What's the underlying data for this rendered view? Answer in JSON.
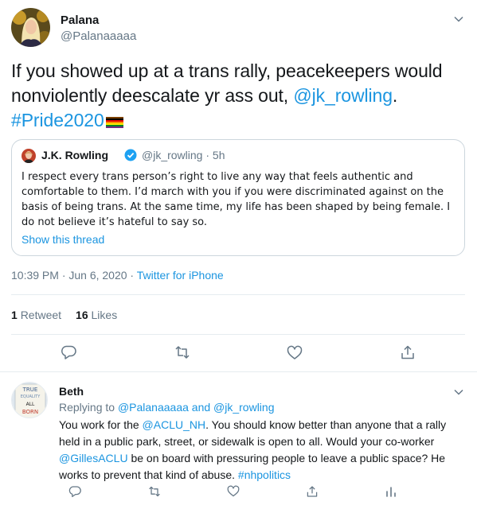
{
  "tweet": {
    "author": {
      "name": "Palana",
      "handle": "@Palanaaaaa"
    },
    "text_before": "If you showed up at a trans rally, peacekeepers would nonviolently deescalate yr ass out, ",
    "mention": "@jk_rowling",
    "text_after": ".",
    "hashtag": "#Pride2020",
    "timestamp": "10:39 PM · Jun 6, 2020",
    "source_separator": " · ",
    "source": "Twitter for iPhone",
    "stats": {
      "retweets_count": "1",
      "retweets_label": "Retweet",
      "likes_count": "16",
      "likes_label": "Likes"
    },
    "actions": [
      "reply-icon",
      "retweet-icon",
      "like-icon",
      "share-icon"
    ]
  },
  "quote": {
    "author": {
      "name": "J.K. Rowling",
      "handle": "@jk_rowling",
      "time": "· 5h"
    },
    "text": "I respect every trans person’s right to live any way that feels authentic and comfortable to them. I’d march with you if you were discriminated against on the basis of being trans. At the same time, my life has been shaped by being female. I do not believe it’s hateful to say so.",
    "show_thread": "Show this thread"
  },
  "reply": {
    "author": {
      "name": "Beth"
    },
    "replying_to_label": "Replying to ",
    "replying_to_1": "@Palanaaaaa",
    "replying_and": " and ",
    "replying_to_2": "@jk_rowling",
    "text_1": "You work for the ",
    "mention_1": "@ACLU_NH",
    "text_2": ". You should know better than anyone that a rally held in a public park, street, or sidewalk is open to all. Would your co-worker ",
    "mention_2": "@GillesACLU",
    "text_3": " be on board with pressuring people to leave a public space? He works to prevent that kind of abuse. ",
    "hashtag": "#nhpolitics",
    "avatar_sign_lines": [
      "TRUE",
      "EQUALITY",
      "ALL",
      "BORN"
    ]
  },
  "colors": {
    "link": "#1b95e0",
    "text": "#14171a",
    "muted": "#657786",
    "border": "#e6ecf0",
    "verified": "#1da1f2"
  }
}
